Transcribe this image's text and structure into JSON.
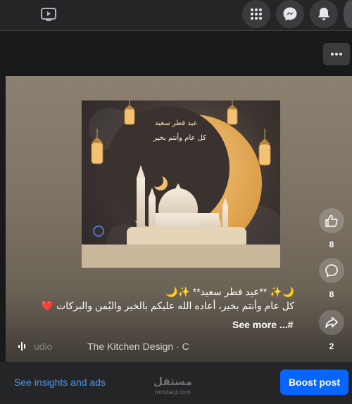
{
  "topbar": {
    "watch_icon": "video-play-icon",
    "menu_icon": "grid-menu-icon",
    "messenger_icon": "messenger-icon",
    "notifications_icon": "bell-icon"
  },
  "post": {
    "more_icon": "more-horizontal-icon",
    "image_text_line1": "عيد فطر سعيد",
    "image_text_line2": "كل عام وأنتم بخير",
    "caption_line1": "🌙✨ **عيد فطر سعيد** ✨🌙",
    "caption_line2": "كل عام وأنتم بخير، أعاده الله عليكم بالخير واليُمن والبركات ❤️",
    "caption_line3": "#... See more",
    "see_more": "See more ...#",
    "audio_label": "udio",
    "audio_track": "The Kitchen Design · C",
    "likes": "8",
    "comments": "8",
    "shares": "2"
  },
  "footer": {
    "insights_link": "See insights and ads",
    "boost_button": "Boost post",
    "watermark_line1": "مستقل",
    "watermark_line2": "mostaql.com"
  },
  "colors": {
    "accent": "#0866ff",
    "link": "#4599ff",
    "bar_bg": "#242526",
    "page_bg": "#18191a"
  }
}
